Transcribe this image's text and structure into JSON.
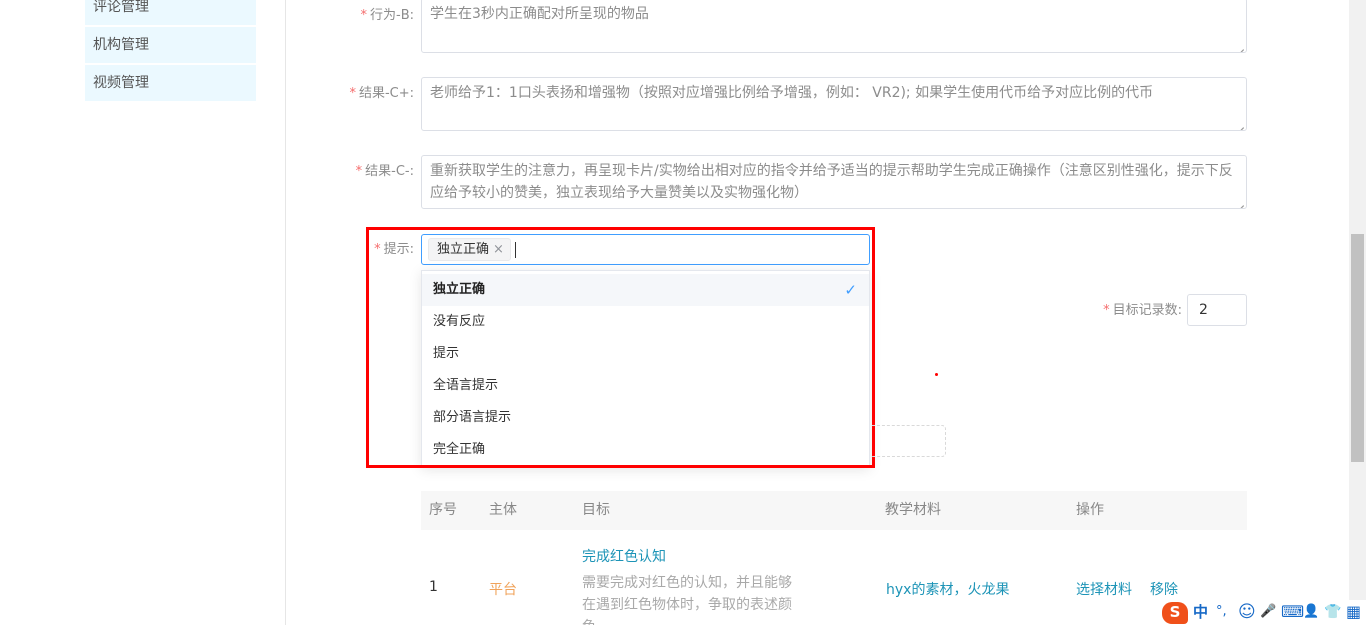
{
  "sidebar": {
    "items": [
      {
        "label": "评论管理"
      },
      {
        "label": "机构管理"
      },
      {
        "label": "视频管理"
      }
    ]
  },
  "form": {
    "behavior": {
      "label": "行为-B:",
      "value": "学生在3秒内正确配对所呈现的物品"
    },
    "result_plus": {
      "label": "结果-C+:",
      "value": "老师给予1：1口头表扬和增强物（按照对应增强比例给予增强，例如： VR2); 如果学生使用代币给予对应比例的代币"
    },
    "result_minus": {
      "label": "结果-C-:",
      "value": "重新获取学生的注意力，再呈现卡片/实物给出相对应的指令并给予适当的提示帮助学生完成正确操作（注意区别性强化，提示下反应给予较小的赞美，独立表现给予大量赞美以及实物强化物）"
    },
    "hint": {
      "label": "提示:",
      "selected_tag": "独立正确",
      "tag_close": "×",
      "options": [
        {
          "label": "独立正确",
          "selected": true
        },
        {
          "label": "没有反应",
          "selected": false
        },
        {
          "label": "提示",
          "selected": false
        },
        {
          "label": "全语言提示",
          "selected": false
        },
        {
          "label": "部分语言提示",
          "selected": false
        },
        {
          "label": "完全正确",
          "selected": false
        }
      ]
    },
    "record_count": {
      "label": "目标记录数:",
      "value": "2"
    }
  },
  "table": {
    "headers": [
      "序号",
      "主体",
      "目标",
      "教学材料",
      "操作"
    ],
    "rows": [
      {
        "index": "1",
        "subject": "平台",
        "goal_title": "完成红色认知",
        "goal_desc": "需要完成对红色的认知，并且能够在遇到红色物体时，争取的表述颜色",
        "materials": "hyx的素材，火龙果",
        "actions": [
          "选择材料",
          "移除"
        ]
      }
    ]
  },
  "ime": {
    "logo": "S",
    "lang": "中",
    "punct": "°,",
    "emoji": "☺",
    "mic": "🎤",
    "keyboard": "⌨",
    "user": "👤",
    "skin": "👕",
    "grid": "▦"
  },
  "colors": {
    "accent": "#409eff",
    "link": "#1d94b7",
    "highlight": "#ff0000",
    "sidebar_bg": "#ebf9ff"
  }
}
